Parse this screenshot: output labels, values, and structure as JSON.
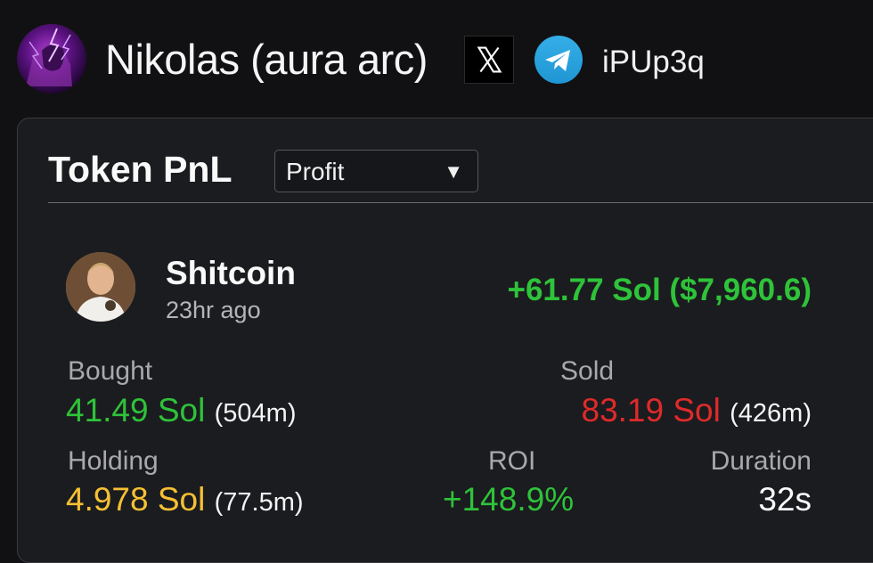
{
  "header": {
    "user_name": "Nikolas (aura arc)",
    "handle": "iPUp3q",
    "icons": [
      "avatar",
      "x-icon",
      "telegram-icon"
    ]
  },
  "card": {
    "title": "Token PnL",
    "filter": {
      "selected": "Profit",
      "arrow": "▼"
    }
  },
  "token": {
    "name": "Shitcoin",
    "time_ago": "23hr ago",
    "profit": "+61.77 Sol ($7,960.6)"
  },
  "stats": {
    "bought": {
      "label": "Bought",
      "value": "41.49 Sol",
      "sub": "(504m)"
    },
    "sold": {
      "label": "Sold",
      "value": "83.19 Sol",
      "sub": "(426m)"
    },
    "holding": {
      "label": "Holding",
      "value": "4.978 Sol",
      "sub": "(77.5m)"
    },
    "roi": {
      "label": "ROI",
      "value": "+148.9%"
    },
    "duration": {
      "label": "Duration",
      "value": "32s"
    }
  },
  "colors": {
    "positive": "#2ec33a",
    "negative": "#e02a2a",
    "holding": "#f6c033",
    "telegram": "#229ED9"
  }
}
